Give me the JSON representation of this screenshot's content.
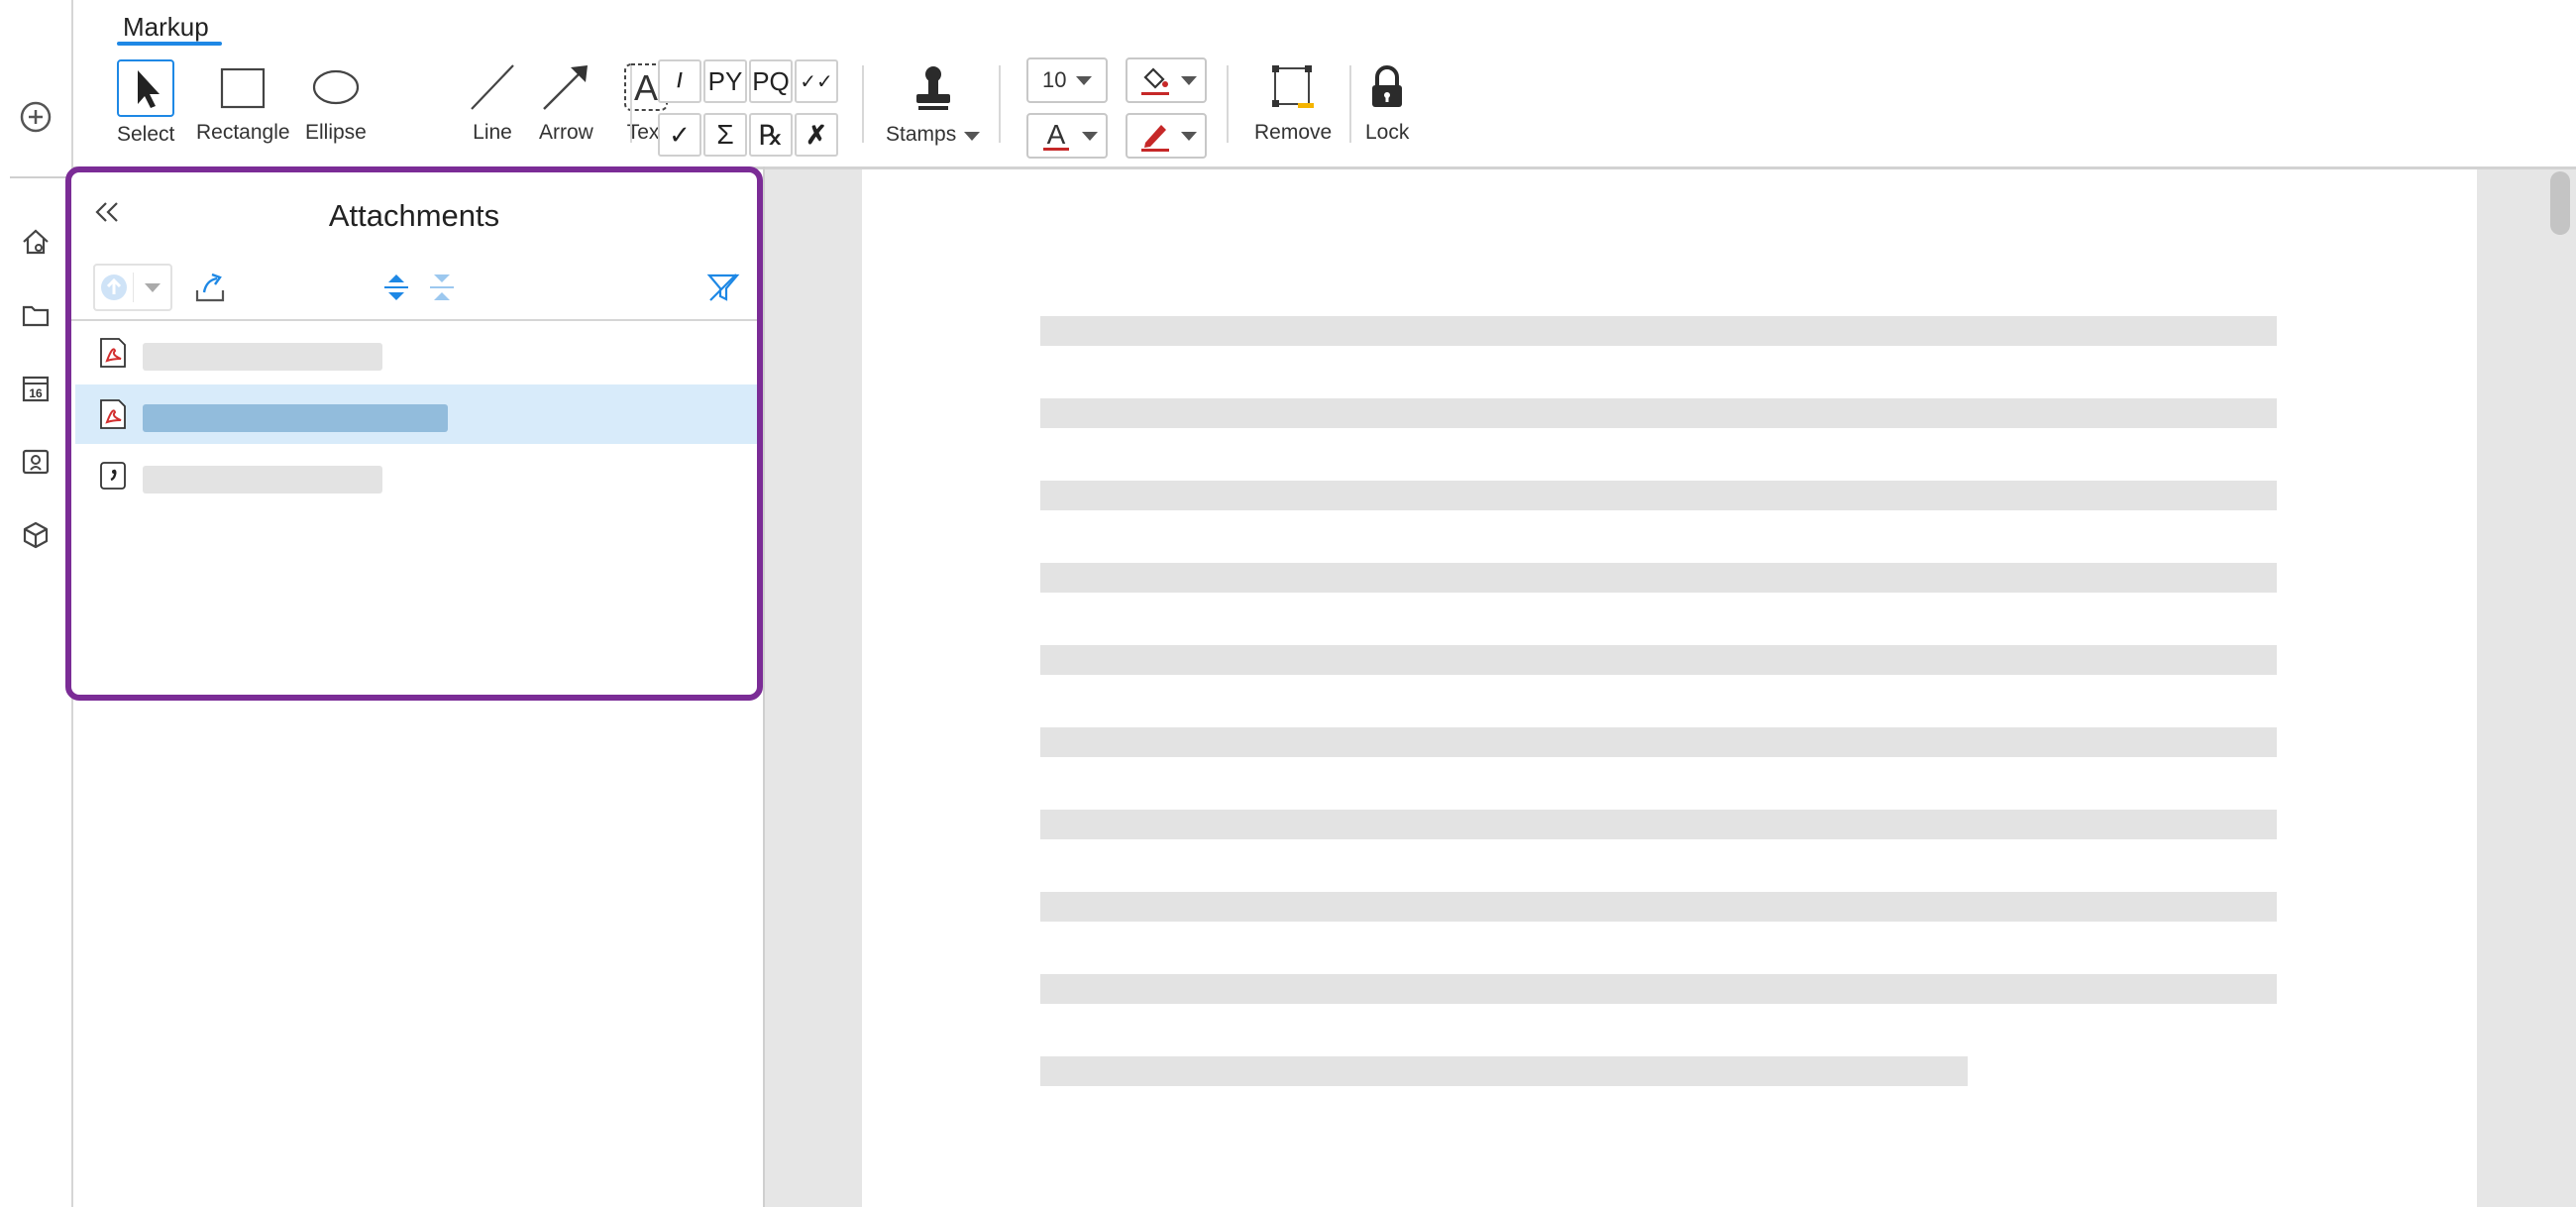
{
  "toolbar": {
    "tab_label": "Markup",
    "tools": [
      {
        "id": "select",
        "label": "Select",
        "icon": "pointer-arrow-icon"
      },
      {
        "id": "rectangle",
        "label": "Rectangle",
        "icon": "rectangle-icon"
      },
      {
        "id": "ellipse",
        "label": "Ellipse",
        "icon": "ellipse-icon"
      },
      {
        "id": "line",
        "label": "Line",
        "icon": "line-icon"
      },
      {
        "id": "arrow",
        "label": "Arrow",
        "icon": "arrow-icon"
      },
      {
        "id": "text",
        "label": "Text",
        "icon": "text-box-icon"
      }
    ],
    "symbol_grid_top": [
      "/",
      "PY",
      "PQ",
      "✓✓"
    ],
    "symbol_grid_bottom": [
      "✓",
      "Σ",
      "℞",
      "✗"
    ],
    "stamps_label": "Stamps",
    "font_size_value": "10",
    "remove_label": "Remove",
    "lock_label": "Lock"
  },
  "rail": {
    "icons": [
      "add-circle-icon",
      "home-icon",
      "folder-icon",
      "calendar-icon",
      "user-badge-icon",
      "cube-icon"
    ],
    "calendar_day": "16"
  },
  "attachments": {
    "title": "Attachments",
    "items": [
      {
        "type": "pdf",
        "name": "",
        "selected": false
      },
      {
        "type": "pdf",
        "name": "",
        "selected": true
      },
      {
        "type": "comment",
        "name": "",
        "selected": false
      }
    ]
  },
  "colors": {
    "accent": "#1e88e5",
    "panel_highlight": "#7b2c96",
    "selected_row": "#d8ebfa",
    "pdf_red": "#d32f2f"
  }
}
